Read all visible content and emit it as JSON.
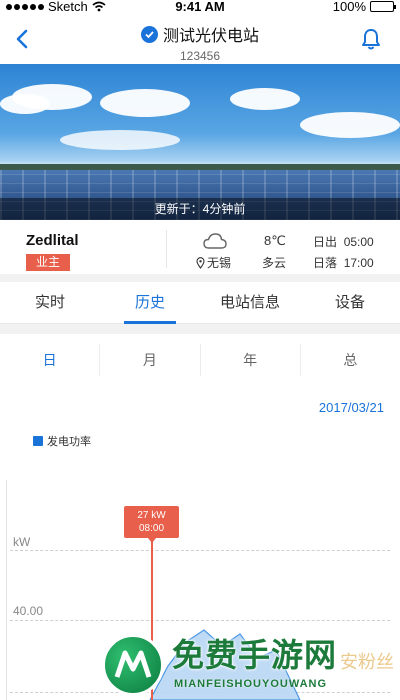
{
  "status_bar": {
    "carrier": "Sketch",
    "time": "9:41 AM",
    "battery": "100%",
    "battery_level": 1.0
  },
  "nav": {
    "title": "测试光伏电站",
    "subtitle": "123456"
  },
  "hero": {
    "update_text": "更新于：4分钟前"
  },
  "info": {
    "owner_name": "Zedlital",
    "owner_tag": "业主",
    "location": "无锡",
    "temperature": "8℃",
    "condition": "多云",
    "sunrise_label": "日出",
    "sunrise_time": "05:00",
    "sunset_label": "日落",
    "sunset_time": "17:00"
  },
  "tabs": [
    {
      "label": "实时"
    },
    {
      "label": "历史"
    },
    {
      "label": "电站信息"
    },
    {
      "label": "设备"
    }
  ],
  "periods": [
    {
      "label": "日"
    },
    {
      "label": "月"
    },
    {
      "label": "年"
    },
    {
      "label": "总"
    }
  ],
  "date": "2017/03/21",
  "legend": {
    "label": "发电功率",
    "color": "#1a73d9"
  },
  "chart": {
    "unit": "kW",
    "y_ticks": [
      "40.00"
    ],
    "tooltip_value": "27 kW",
    "tooltip_time": "08:00"
  },
  "watermark": {
    "text": "免费手游网",
    "sub": "MIANFEISHOUYOUWANG",
    "right": "安粉丝"
  },
  "colors": {
    "accent": "#1a73d9",
    "tag": "#e8604c"
  }
}
